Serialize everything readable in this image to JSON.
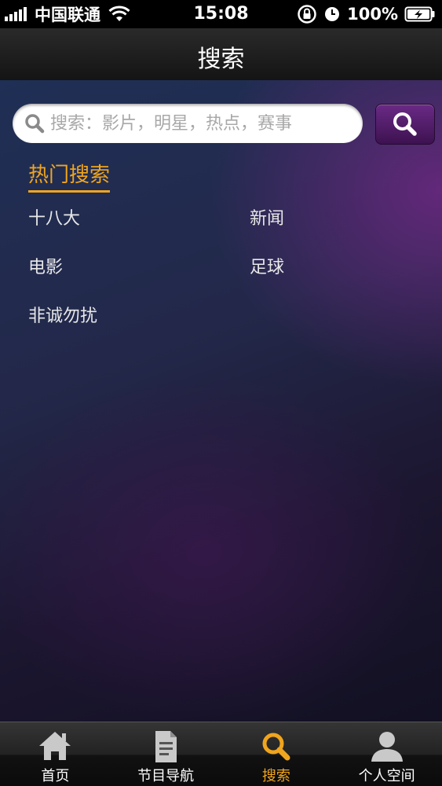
{
  "status_bar": {
    "carrier": "中国联通",
    "time": "15:08",
    "battery": "100%"
  },
  "nav": {
    "title": "搜索"
  },
  "search": {
    "placeholder": "搜索：影片，明星，热点，赛事",
    "value": ""
  },
  "hot_search": {
    "title": "热门搜索",
    "items": [
      "十八大",
      "新闻",
      "电影",
      "足球",
      "非诚勿扰"
    ]
  },
  "tabs": [
    {
      "label": "首页",
      "icon": "home-icon"
    },
    {
      "label": "节目导航",
      "icon": "document-icon"
    },
    {
      "label": "搜索",
      "icon": "search-icon"
    },
    {
      "label": "个人空间",
      "icon": "user-icon"
    }
  ],
  "active_tab": 2,
  "colors": {
    "accent": "#f0a51e",
    "button_purple": "#5a1f72"
  }
}
